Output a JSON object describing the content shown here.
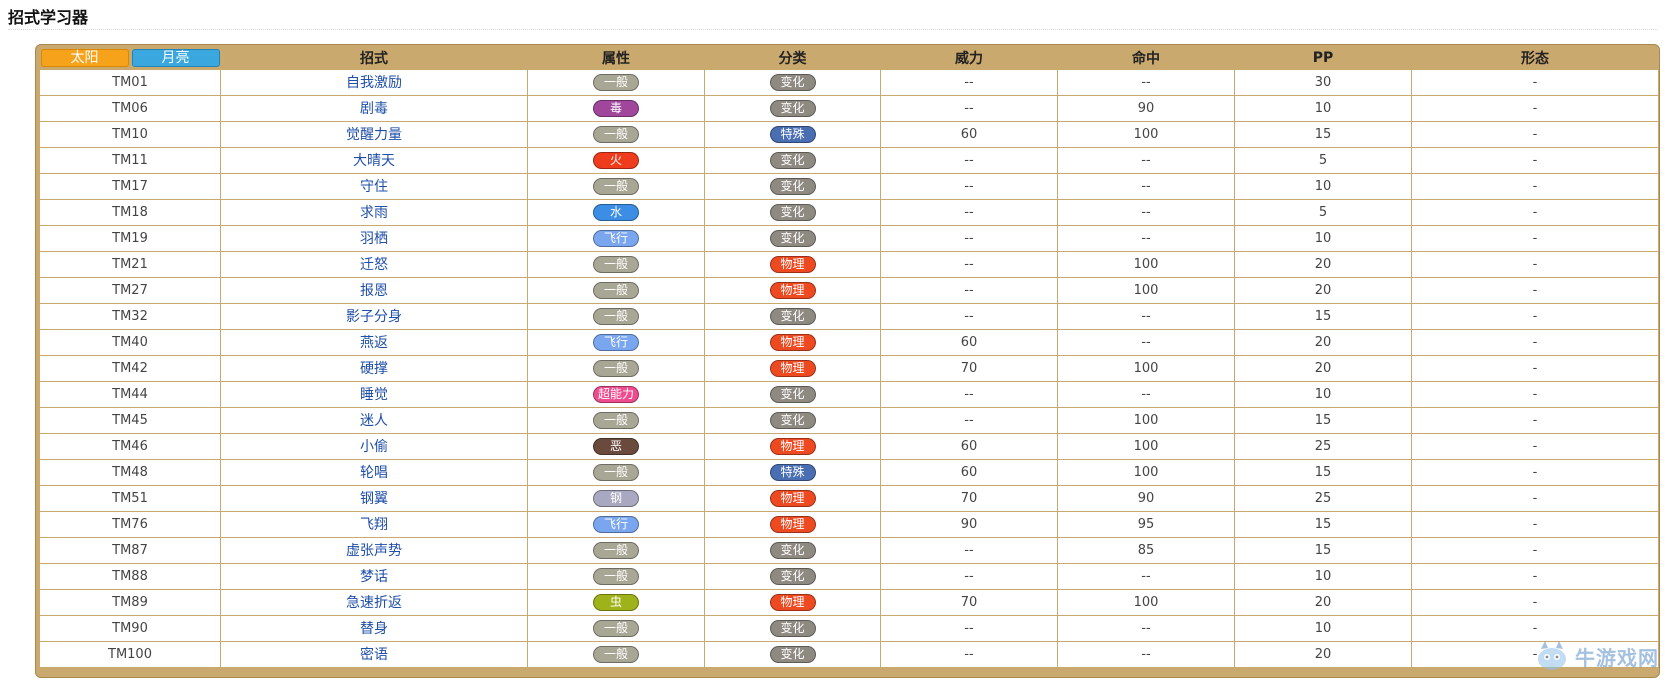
{
  "page": {
    "title": "招式学习器"
  },
  "tabs": {
    "sun": "太阳",
    "moon": "月亮"
  },
  "columns": [
    "招式",
    "属性",
    "分类",
    "威力",
    "命中",
    "PP",
    "形态"
  ],
  "colors": {
    "type": {
      "一般": "#a8a796",
      "毒": "#a0479c",
      "火": "#ee3c1c",
      "水": "#3b8ee3",
      "飞行": "#7aa6f0",
      "超能力": "#ee4c8e",
      "恶": "#6b4a3e",
      "钢": "#a8a8c0",
      "虫": "#a0b21a"
    },
    "category": {
      "变化": "#8e8a82",
      "特殊": "#4a6eb2",
      "物理": "#ee4a22"
    },
    "accent_frame": "#c9a96e"
  },
  "rows": [
    {
      "tm": "TM01",
      "move": "自我激励",
      "type": "一般",
      "category": "变化",
      "power": "--",
      "accuracy": "--",
      "pp": "30",
      "form": "-"
    },
    {
      "tm": "TM06",
      "move": "剧毒",
      "type": "毒",
      "category": "变化",
      "power": "--",
      "accuracy": "90",
      "pp": "10",
      "form": "-"
    },
    {
      "tm": "TM10",
      "move": "觉醒力量",
      "type": "一般",
      "category": "特殊",
      "power": "60",
      "accuracy": "100",
      "pp": "15",
      "form": "-"
    },
    {
      "tm": "TM11",
      "move": "大晴天",
      "type": "火",
      "category": "变化",
      "power": "--",
      "accuracy": "--",
      "pp": "5",
      "form": "-"
    },
    {
      "tm": "TM17",
      "move": "守住",
      "type": "一般",
      "category": "变化",
      "power": "--",
      "accuracy": "--",
      "pp": "10",
      "form": "-"
    },
    {
      "tm": "TM18",
      "move": "求雨",
      "type": "水",
      "category": "变化",
      "power": "--",
      "accuracy": "--",
      "pp": "5",
      "form": "-"
    },
    {
      "tm": "TM19",
      "move": "羽栖",
      "type": "飞行",
      "category": "变化",
      "power": "--",
      "accuracy": "--",
      "pp": "10",
      "form": "-"
    },
    {
      "tm": "TM21",
      "move": "迁怒",
      "type": "一般",
      "category": "物理",
      "power": "--",
      "accuracy": "100",
      "pp": "20",
      "form": "-"
    },
    {
      "tm": "TM27",
      "move": "报恩",
      "type": "一般",
      "category": "物理",
      "power": "--",
      "accuracy": "100",
      "pp": "20",
      "form": "-"
    },
    {
      "tm": "TM32",
      "move": "影子分身",
      "type": "一般",
      "category": "变化",
      "power": "--",
      "accuracy": "--",
      "pp": "15",
      "form": "-"
    },
    {
      "tm": "TM40",
      "move": "燕返",
      "type": "飞行",
      "category": "物理",
      "power": "60",
      "accuracy": "--",
      "pp": "20",
      "form": "-"
    },
    {
      "tm": "TM42",
      "move": "硬撑",
      "type": "一般",
      "category": "物理",
      "power": "70",
      "accuracy": "100",
      "pp": "20",
      "form": "-"
    },
    {
      "tm": "TM44",
      "move": "睡觉",
      "type": "超能力",
      "category": "变化",
      "power": "--",
      "accuracy": "--",
      "pp": "10",
      "form": "-"
    },
    {
      "tm": "TM45",
      "move": "迷人",
      "type": "一般",
      "category": "变化",
      "power": "--",
      "accuracy": "100",
      "pp": "15",
      "form": "-"
    },
    {
      "tm": "TM46",
      "move": "小偷",
      "type": "恶",
      "category": "物理",
      "power": "60",
      "accuracy": "100",
      "pp": "25",
      "form": "-"
    },
    {
      "tm": "TM48",
      "move": "轮唱",
      "type": "一般",
      "category": "特殊",
      "power": "60",
      "accuracy": "100",
      "pp": "15",
      "form": "-"
    },
    {
      "tm": "TM51",
      "move": "钢翼",
      "type": "钢",
      "category": "物理",
      "power": "70",
      "accuracy": "90",
      "pp": "25",
      "form": "-"
    },
    {
      "tm": "TM76",
      "move": "飞翔",
      "type": "飞行",
      "category": "物理",
      "power": "90",
      "accuracy": "95",
      "pp": "15",
      "form": "-"
    },
    {
      "tm": "TM87",
      "move": "虚张声势",
      "type": "一般",
      "category": "变化",
      "power": "--",
      "accuracy": "85",
      "pp": "15",
      "form": "-"
    },
    {
      "tm": "TM88",
      "move": "梦话",
      "type": "一般",
      "category": "变化",
      "power": "--",
      "accuracy": "--",
      "pp": "10",
      "form": "-"
    },
    {
      "tm": "TM89",
      "move": "急速折返",
      "type": "虫",
      "category": "物理",
      "power": "70",
      "accuracy": "100",
      "pp": "20",
      "form": "-"
    },
    {
      "tm": "TM90",
      "move": "替身",
      "type": "一般",
      "category": "变化",
      "power": "--",
      "accuracy": "--",
      "pp": "10",
      "form": "-"
    },
    {
      "tm": "TM100",
      "move": "密语",
      "type": "一般",
      "category": "变化",
      "power": "--",
      "accuracy": "--",
      "pp": "20",
      "form": "-"
    }
  ],
  "watermark": {
    "text": "牛游戏网",
    "icon": "mascot-logo-icon"
  }
}
